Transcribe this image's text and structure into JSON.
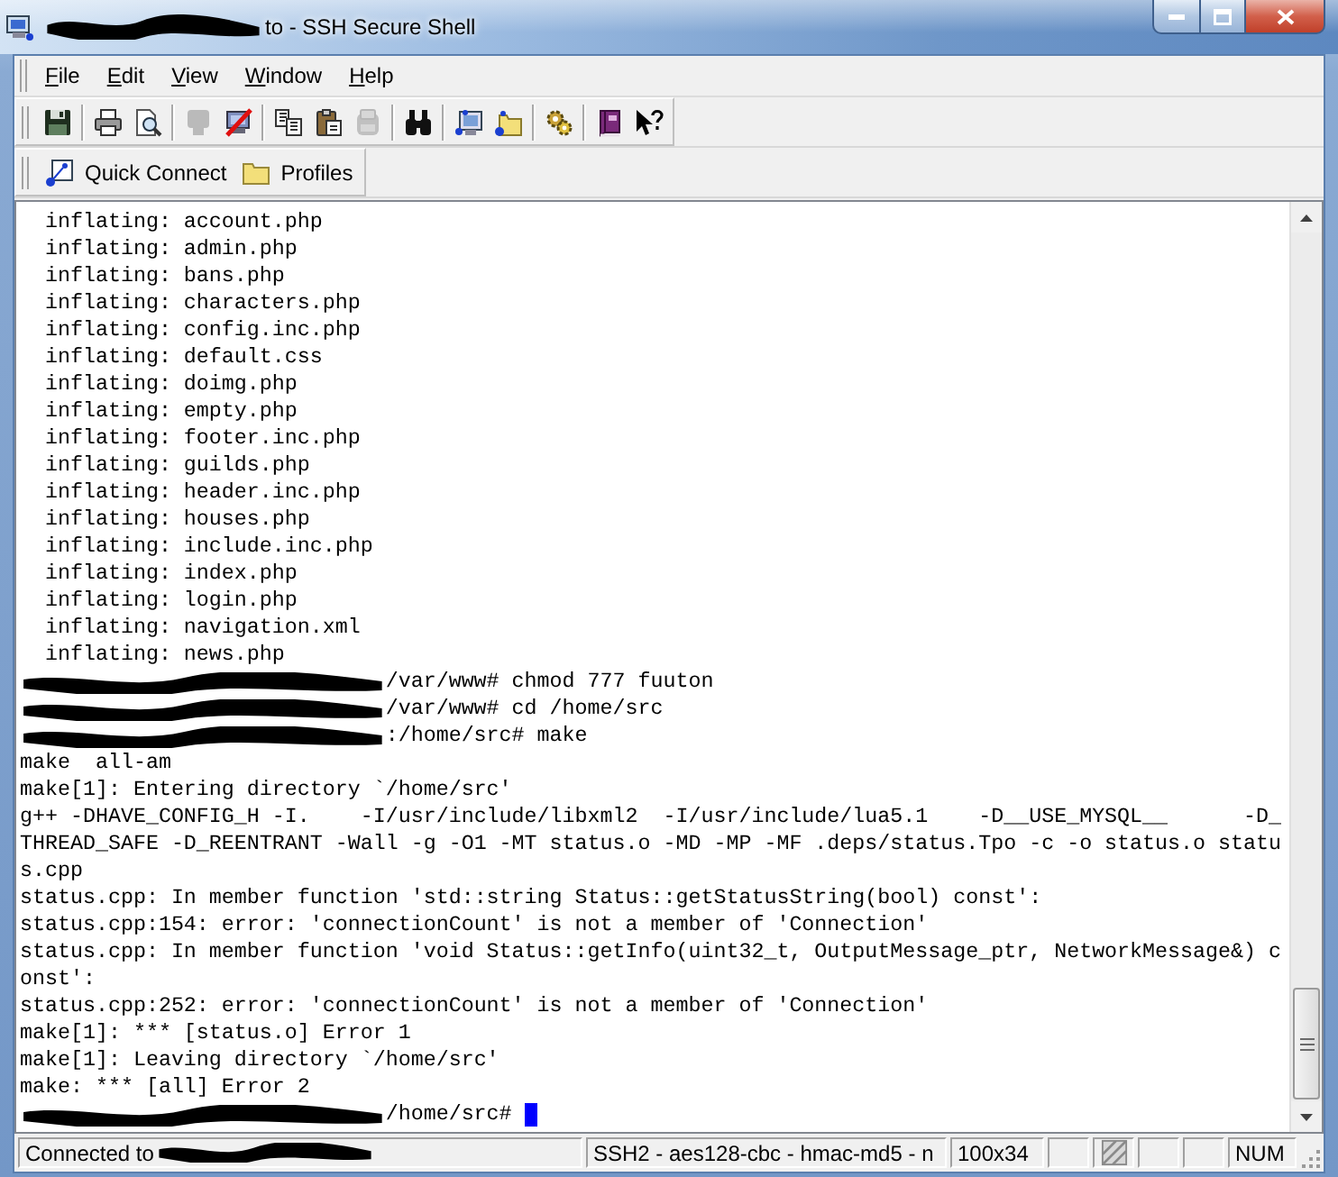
{
  "window": {
    "title": "to - SSH Secure Shell",
    "title_redacted": true
  },
  "menu": [
    {
      "label": "File"
    },
    {
      "label": "Edit"
    },
    {
      "label": "View"
    },
    {
      "label": "Window"
    },
    {
      "label": "Help"
    }
  ],
  "toolbar": [
    [
      {
        "disabled": false
      }
    ],
    [
      {
        "disabled": false
      },
      {
        "disabled": false
      }
    ],
    [
      {
        "disabled": true
      },
      {
        "disabled": false
      }
    ],
    [
      {
        "disabled": false
      },
      {
        "disabled": false
      },
      {
        "disabled": true
      }
    ],
    [
      {
        "disabled": false
      }
    ],
    [
      {
        "disabled": false
      },
      {
        "disabled": false
      }
    ],
    [
      {
        "disabled": false
      }
    ],
    [
      {
        "disabled": false
      },
      {
        "disabled": false
      }
    ]
  ],
  "quick_bar": [
    {
      "label": "Quick Connect"
    },
    {
      "label": "Profiles"
    }
  ],
  "terminal": {
    "cursor": true,
    "lines": [
      {
        "kind": "output",
        "text": "  inflating: account.php"
      },
      {
        "kind": "output",
        "text": "  inflating: admin.php"
      },
      {
        "kind": "output",
        "text": "  inflating: bans.php"
      },
      {
        "kind": "output",
        "text": "  inflating: characters.php"
      },
      {
        "kind": "output",
        "text": "  inflating: config.inc.php"
      },
      {
        "kind": "output",
        "text": "  inflating: default.css"
      },
      {
        "kind": "output",
        "text": "  inflating: doimg.php"
      },
      {
        "kind": "output",
        "text": "  inflating: empty.php"
      },
      {
        "kind": "output",
        "text": "  inflating: footer.inc.php"
      },
      {
        "kind": "output",
        "text": "  inflating: guilds.php"
      },
      {
        "kind": "output",
        "text": "  inflating: header.inc.php"
      },
      {
        "kind": "output",
        "text": "  inflating: houses.php"
      },
      {
        "kind": "output",
        "text": "  inflating: include.inc.php"
      },
      {
        "kind": "output",
        "text": "  inflating: index.php"
      },
      {
        "kind": "output",
        "text": "  inflating: login.php"
      },
      {
        "kind": "output",
        "text": "  inflating: navigation.xml"
      },
      {
        "kind": "output",
        "text": "  inflating: news.php"
      },
      {
        "kind": "prompt",
        "text": "/var/www# chmod 777 fuuton"
      },
      {
        "kind": "prompt",
        "text": "/var/www# cd /home/src"
      },
      {
        "kind": "prompt",
        "text": ":/home/src# make"
      },
      {
        "kind": "output",
        "text": "make  all-am"
      },
      {
        "kind": "output",
        "text": "make[1]: Entering directory `/home/src'"
      },
      {
        "kind": "output",
        "text": "g++ -DHAVE_CONFIG_H -I.    -I/usr/include/libxml2  -I/usr/include/lua5.1    -D__USE_MYSQL__      -D_"
      },
      {
        "kind": "output",
        "text": "THREAD_SAFE -D_REENTRANT -Wall -g -O1 -MT status.o -MD -MP -MF .deps/status.Tpo -c -o status.o statu"
      },
      {
        "kind": "output",
        "text": "s.cpp"
      },
      {
        "kind": "output",
        "text": "status.cpp: In member function 'std::string Status::getStatusString(bool) const':"
      },
      {
        "kind": "output",
        "text": "status.cpp:154: error: 'connectionCount' is not a member of 'Connection'"
      },
      {
        "kind": "output",
        "text": "status.cpp: In member function 'void Status::getInfo(uint32_t, OutputMessage_ptr, NetworkMessage&) c"
      },
      {
        "kind": "output",
        "text": "onst':"
      },
      {
        "kind": "output",
        "text": "status.cpp:252: error: 'connectionCount' is not a member of 'Connection'"
      },
      {
        "kind": "output",
        "text": "make[1]: *** [status.o] Error 1"
      },
      {
        "kind": "output",
        "text": "make[1]: Leaving directory `/home/src'"
      },
      {
        "kind": "output",
        "text": "make: *** [all] Error 2"
      },
      {
        "kind": "prompt",
        "text": "/home/src#"
      }
    ]
  },
  "status_bar": [
    {
      "kind": "text",
      "text": "Connected to",
      "redacted": true
    },
    {
      "kind": "text",
      "text": "SSH2 - aes128-cbc - hmac-md5 - n",
      "redacted": false
    },
    {
      "kind": "text",
      "text": "100x34",
      "redacted": false
    },
    {
      "kind": "blank"
    },
    {
      "kind": "icon"
    },
    {
      "kind": "blank"
    },
    {
      "kind": "blank"
    },
    {
      "kind": "text",
      "text": "NUM",
      "redacted": false
    }
  ]
}
